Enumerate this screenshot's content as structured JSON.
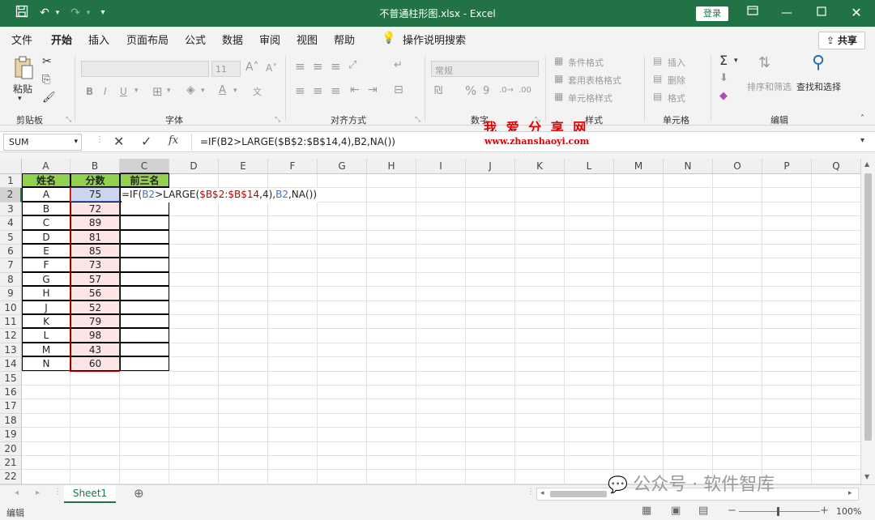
{
  "window": {
    "title": "不普通柱形图.xlsx  -  Excel",
    "login": "登录"
  },
  "menu": {
    "tabs": [
      "文件",
      "开始",
      "插入",
      "页面布局",
      "公式",
      "数据",
      "审阅",
      "视图",
      "帮助"
    ],
    "tell_me": "操作说明搜索",
    "share": "共享"
  },
  "ribbon": {
    "paste": "粘贴",
    "clipboard": "剪贴板",
    "font_group": "字体",
    "font_size": "11",
    "align_group": "对齐方式",
    "number_format": "常规",
    "number_group": "数字",
    "cond_format": "条件格式",
    "table_format": "套用表格格式",
    "cell_style": "单元格样式",
    "styles_group": "样式",
    "insert": "插入",
    "delete": "删除",
    "format": "格式",
    "cells_group": "单元格",
    "sort_filter": "排序和筛选",
    "find_select": "查找和选择",
    "edit_group": "编辑"
  },
  "watermark": {
    "site_cn": "我 爱 分 享 网",
    "site_url": "www.zhanshaoyi.com",
    "wechat": "公众号 · 软件智库"
  },
  "formula_bar": {
    "name_box": "SUM",
    "formula": "=IF(B2>LARGE($B$2:$B$14,4),B2,NA())"
  },
  "columns": [
    "A",
    "B",
    "C",
    "D",
    "E",
    "F",
    "G",
    "H",
    "I",
    "J",
    "K",
    "L",
    "M",
    "N",
    "O",
    "P",
    "Q"
  ],
  "rows": [
    "1",
    "2",
    "3",
    "4",
    "5",
    "6",
    "7",
    "8",
    "9",
    "10",
    "11",
    "12",
    "13",
    "14",
    "15",
    "16",
    "17",
    "18",
    "19",
    "20",
    "21",
    "22"
  ],
  "table": {
    "headers": [
      "姓名",
      "分数",
      "前三名"
    ],
    "names": [
      "A",
      "B",
      "C",
      "D",
      "E",
      "F",
      "G",
      "H",
      "J",
      "K",
      "L",
      "M",
      "N"
    ],
    "scores": [
      "75",
      "72",
      "89",
      "81",
      "85",
      "73",
      "57",
      "56",
      "52",
      "79",
      "98",
      "43",
      "60"
    ]
  },
  "edit_formula": {
    "p1": "=IF(",
    "p2": "B2",
    "p3": ">LARGE(",
    "p4": "$B$2:$B$14",
    "p5": ",4),",
    "p6": "B2",
    "p7": ",NA())"
  },
  "sheet": {
    "tab": "Sheet1"
  },
  "status": {
    "mode": "编辑",
    "zoom": "100%"
  },
  "colors": {
    "accent": "#217346",
    "header_green": "#92d050",
    "ref_blue": "#4472c4",
    "ref_red": "#c00000"
  }
}
